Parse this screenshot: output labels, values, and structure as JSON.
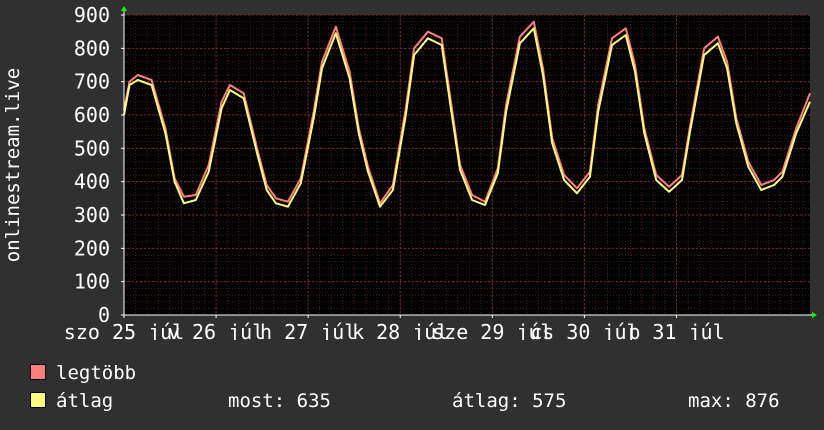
{
  "chart_data": {
    "type": "line",
    "ylabel": "onlinestream.live",
    "ylim": [
      0,
      900
    ],
    "yticks": [
      0,
      100,
      200,
      300,
      400,
      500,
      600,
      700,
      800,
      900
    ],
    "xlim_days": [
      0,
      7.45
    ],
    "xtick_labels": [
      {
        "day": 0,
        "label": "szo 25 júl"
      },
      {
        "day": 1,
        "label": "v 26 júl"
      },
      {
        "day": 2,
        "label": "h 27 júl"
      },
      {
        "day": 3,
        "label": "k 28 júl"
      },
      {
        "day": 4,
        "label": "sze 29 júl"
      },
      {
        "day": 5,
        "label": "cs 30 júl"
      },
      {
        "day": 6,
        "label": "p 31 júl"
      }
    ],
    "grid": true,
    "series": [
      {
        "name": "legtöbb",
        "color": "#ff7f7f",
        "x": [
          0.0,
          0.06,
          0.15,
          0.3,
          0.45,
          0.55,
          0.65,
          0.78,
          0.92,
          1.06,
          1.15,
          1.3,
          1.45,
          1.55,
          1.65,
          1.78,
          1.92,
          2.06,
          2.15,
          2.3,
          2.45,
          2.55,
          2.65,
          2.78,
          2.92,
          3.06,
          3.15,
          3.3,
          3.45,
          3.55,
          3.65,
          3.78,
          3.92,
          4.06,
          4.15,
          4.3,
          4.45,
          4.55,
          4.65,
          4.78,
          4.92,
          5.06,
          5.15,
          5.3,
          5.45,
          5.55,
          5.65,
          5.78,
          5.92,
          6.06,
          6.15,
          6.3,
          6.45,
          6.55,
          6.65,
          6.78,
          6.92,
          7.06,
          7.15,
          7.3,
          7.45
        ],
        "values": [
          615,
          700,
          720,
          705,
          560,
          410,
          355,
          360,
          450,
          640,
          690,
          665,
          495,
          390,
          350,
          340,
          410,
          610,
          760,
          865,
          730,
          560,
          445,
          335,
          390,
          620,
          800,
          850,
          830,
          640,
          450,
          360,
          340,
          440,
          630,
          835,
          880,
          740,
          530,
          420,
          380,
          430,
          630,
          830,
          860,
          750,
          560,
          420,
          385,
          420,
          570,
          800,
          835,
          760,
          590,
          460,
          390,
          405,
          430,
          560,
          665
        ]
      },
      {
        "name": "átlag",
        "color": "#ffff7f",
        "x": [
          0.0,
          0.06,
          0.15,
          0.3,
          0.45,
          0.55,
          0.65,
          0.78,
          0.92,
          1.06,
          1.15,
          1.3,
          1.45,
          1.55,
          1.65,
          1.78,
          1.92,
          2.06,
          2.15,
          2.3,
          2.45,
          2.55,
          2.65,
          2.78,
          2.92,
          3.06,
          3.15,
          3.3,
          3.45,
          3.55,
          3.65,
          3.78,
          3.92,
          4.06,
          4.15,
          4.3,
          4.45,
          4.55,
          4.65,
          4.78,
          4.92,
          5.06,
          5.15,
          5.3,
          5.45,
          5.55,
          5.65,
          5.78,
          5.92,
          6.06,
          6.15,
          6.3,
          6.45,
          6.55,
          6.65,
          6.78,
          6.92,
          7.06,
          7.15,
          7.3,
          7.45
        ],
        "values": [
          600,
          690,
          705,
          690,
          545,
          400,
          335,
          345,
          430,
          620,
          675,
          650,
          480,
          375,
          335,
          325,
          395,
          590,
          740,
          845,
          710,
          545,
          430,
          325,
          375,
          600,
          780,
          830,
          810,
          620,
          435,
          345,
          330,
          425,
          610,
          815,
          860,
          720,
          515,
          405,
          365,
          415,
          610,
          810,
          840,
          730,
          545,
          405,
          370,
          405,
          555,
          780,
          815,
          740,
          575,
          445,
          375,
          390,
          415,
          545,
          640
        ]
      }
    ]
  },
  "legend": [
    {
      "label": "legtöbb",
      "color": "#ff7f7f"
    },
    {
      "label": "átlag",
      "color": "#ffff7f"
    }
  ],
  "stats": {
    "most": "most: 635",
    "atlag": "átlag: 575",
    "max": "max: 876"
  },
  "colors": {
    "background": "#303030",
    "plot_background": "#000000",
    "grid_minor": "#4a1c1c",
    "grid_major": "#7a2a2a",
    "axis": "#ffffff",
    "arrow": "#00ff00"
  }
}
